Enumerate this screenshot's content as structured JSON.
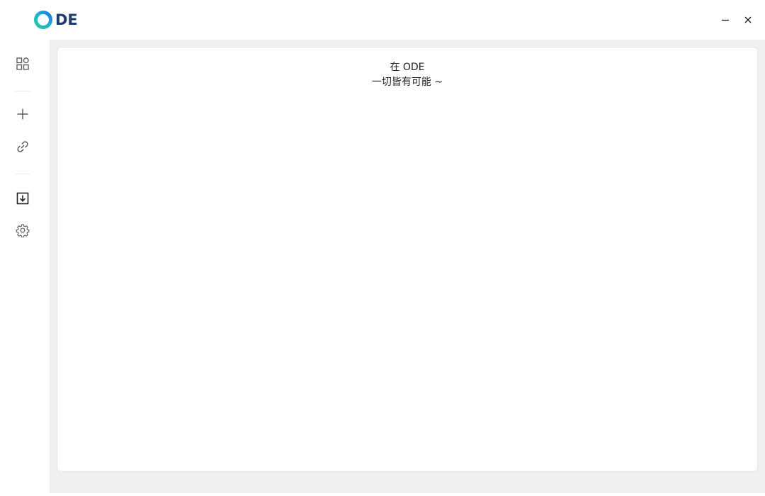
{
  "app": {
    "logo_text": "DE",
    "colors": {
      "logo_ring_start": "#21c7a8",
      "logo_ring_end": "#1a73e8",
      "logo_text": "#1f3a6e",
      "main_bg": "#f0f0f0",
      "card_bg": "#ffffff"
    }
  },
  "window_controls": {
    "minimize_icon": "minimize-icon",
    "close_icon": "close-icon"
  },
  "sidebar": {
    "items": [
      {
        "icon": "grid-apps-icon"
      },
      {
        "icon": "plus-icon"
      },
      {
        "icon": "link-icon"
      },
      {
        "icon": "download-box-icon"
      },
      {
        "icon": "gear-icon"
      }
    ]
  },
  "main": {
    "welcome_line1": "在 ODE",
    "welcome_line2": "一切皆有可能 ~"
  }
}
